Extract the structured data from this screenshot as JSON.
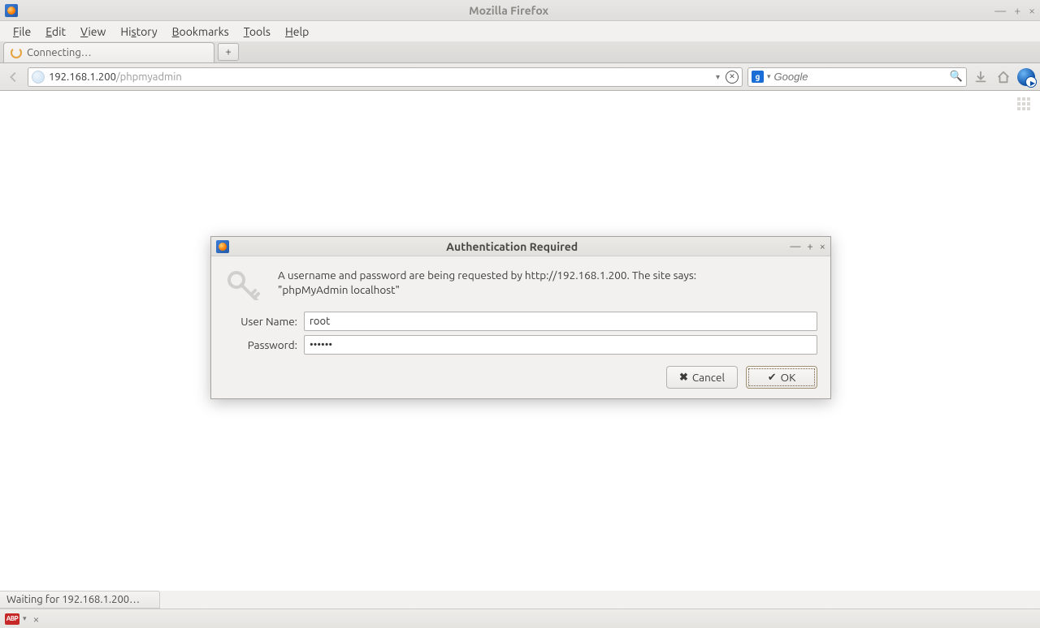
{
  "window": {
    "title": "Mozilla Firefox"
  },
  "menubar": {
    "file": "File",
    "edit": "Edit",
    "view": "View",
    "history": "History",
    "bookmarks": "Bookmarks",
    "tools": "Tools",
    "help": "Help"
  },
  "tabs": {
    "active_label": "Connecting…",
    "newtab_symbol": "+"
  },
  "urlbar": {
    "host": "192.168.1.200",
    "path": "/phpmyadmin"
  },
  "searchbar": {
    "engine_badge": "g",
    "placeholder": "Google"
  },
  "statusbar": {
    "text": "Waiting for 192.168.1.200…"
  },
  "addonbar": {
    "abp_label": "ABP"
  },
  "dialog": {
    "title": "Authentication Required",
    "message": "A username and password are being requested by http://192.168.1.200. The site says: \"phpMyAdmin localhost\"",
    "username_label": "User Name:",
    "password_label": "Password:",
    "username_value": "root",
    "password_value": "••••••",
    "cancel_label": "Cancel",
    "ok_label": "OK"
  }
}
